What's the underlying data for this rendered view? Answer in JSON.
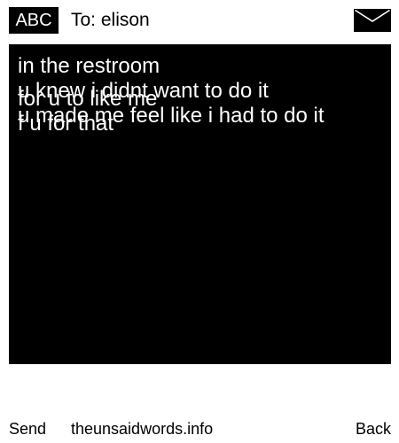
{
  "header": {
    "mode_badge": "ABC",
    "recipient": "To: elison",
    "send_icon": "envelope-icon"
  },
  "message": {
    "lines": [
      "in the restroom",
      "u knew i didnt want to do it",
      "for u to like me",
      "u made me feel like i had to do it",
      "f u for that"
    ]
  },
  "footer": {
    "send_label": "Send",
    "site_label": "theunsaidwords.info",
    "back_label": "Back"
  },
  "colors": {
    "background": "#ffffff",
    "message_background": "#000000",
    "message_text": "#ffffff"
  }
}
